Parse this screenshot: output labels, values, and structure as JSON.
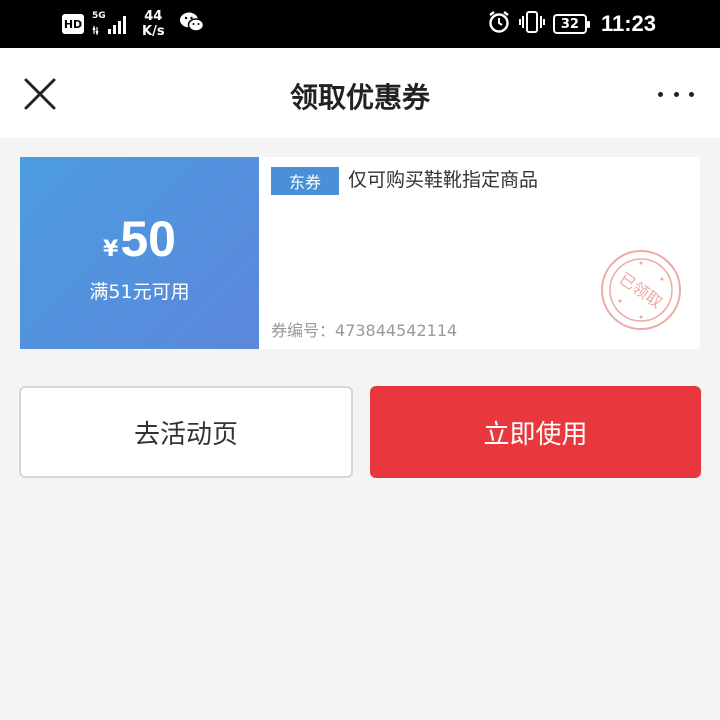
{
  "status_bar": {
    "hd": "HD",
    "network": "5G",
    "speed_value": "44",
    "speed_unit": "K/s",
    "battery": "32",
    "time": "11:23"
  },
  "header": {
    "title": "领取优惠券"
  },
  "coupon": {
    "currency": "¥",
    "amount": "50",
    "condition": "满51元可用",
    "tag": "东券",
    "description": "仅可购买鞋靴指定商品",
    "number_label": "券编号：",
    "number": "473844542114",
    "stamp_text": "已领取"
  },
  "actions": {
    "activity_label": "去活动页",
    "use_label": "立即使用"
  },
  "colors": {
    "coupon_gradient_start": "#4c9ce0",
    "coupon_gradient_end": "#5b87db",
    "tag_bg": "#4a90d9",
    "primary_red": "#e8373d",
    "stamp_red": "#e9a49c",
    "page_bg": "#f4f4f4"
  }
}
